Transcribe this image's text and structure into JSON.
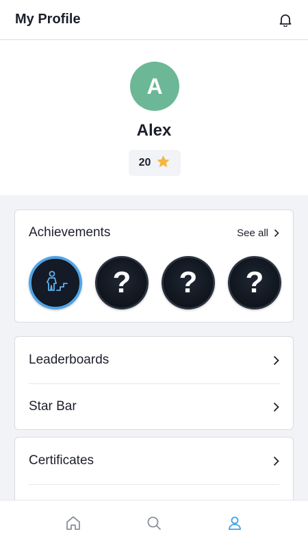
{
  "header": {
    "title": "My Profile",
    "icon": "bell-icon"
  },
  "profile": {
    "avatar_letter": "A",
    "avatar_color": "#6cb896",
    "name": "Alex",
    "stars": "20",
    "star_color": "#f4b63f"
  },
  "achievements": {
    "title": "Achievements",
    "see_all_label": "See all",
    "badges": [
      {
        "state": "unlocked",
        "icon": "climbing-stairs-icon"
      },
      {
        "state": "locked",
        "symbol": "?"
      },
      {
        "state": "locked",
        "symbol": "?"
      },
      {
        "state": "locked",
        "symbol": "?"
      }
    ]
  },
  "menu": {
    "items": [
      {
        "label": "Leaderboards"
      },
      {
        "label": "Star Bar"
      }
    ]
  },
  "menu2": {
    "items": [
      {
        "label": "Certificates"
      }
    ]
  },
  "tabbar": {
    "tabs": [
      {
        "name": "home",
        "icon": "home-icon",
        "active": false
      },
      {
        "name": "search",
        "icon": "search-icon",
        "active": false
      },
      {
        "name": "profile",
        "icon": "user-icon",
        "active": true
      }
    ],
    "active_color": "#3ba3e6",
    "inactive_color": "#8a8f99"
  }
}
